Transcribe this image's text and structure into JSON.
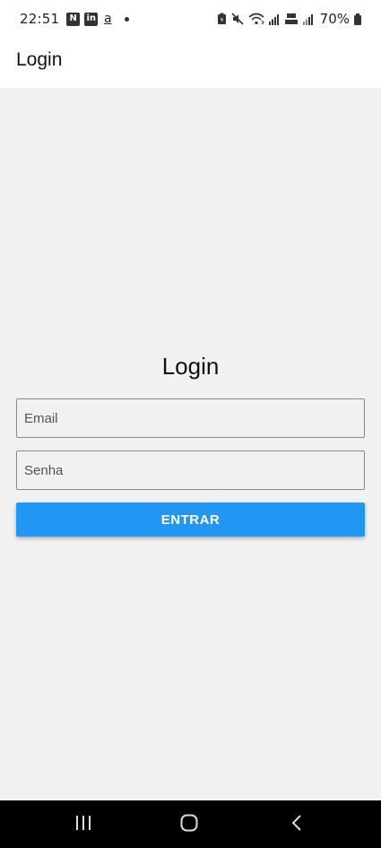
{
  "status_bar": {
    "time": "22:51",
    "apps": [
      "N",
      "in",
      "a"
    ],
    "battery_percent": "70%"
  },
  "app_bar": {
    "title": "Login"
  },
  "form": {
    "heading": "Login",
    "email_placeholder": "Email",
    "password_placeholder": "Senha",
    "submit_label": "ENTRAR"
  },
  "colors": {
    "accent": "#2196f3",
    "background": "#f1f1f1",
    "nav_bar": "#000000"
  },
  "icons": {
    "status": [
      "battery-saver-icon",
      "mute-icon",
      "wifi-icon",
      "signal-icon",
      "volte-icon",
      "signal-icon",
      "battery-icon"
    ],
    "nav": [
      "recents-icon",
      "home-icon",
      "back-icon"
    ]
  }
}
